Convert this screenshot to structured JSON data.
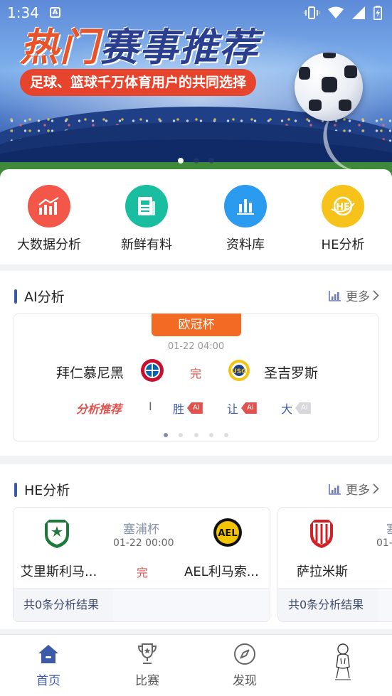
{
  "status_bar": {
    "time": "1:34",
    "notif_letter": "A"
  },
  "banner": {
    "title_part1": "热门",
    "title_part2": "赛事推荐",
    "subtitle": "足球、篮球千万体育用户的共同选择",
    "dots": 3,
    "active_dot": 0
  },
  "menu": [
    {
      "label": "大数据分析",
      "icon": "bar-chart-trend-icon",
      "color": "#f2574a"
    },
    {
      "label": "新鲜有料",
      "icon": "news-doc-icon",
      "color": "#19bd9f"
    },
    {
      "label": "资料库",
      "icon": "database-bars-icon",
      "color": "#2b9bef"
    },
    {
      "label": "HE分析",
      "icon": "he-globe-icon",
      "color": "#f7c21a"
    }
  ],
  "ai_section": {
    "title": "AI分析",
    "more": "更多",
    "match": {
      "league": "欧冠杯",
      "time": "01-22 04:00",
      "home": "拜仁慕尼黑",
      "away": "圣吉罗斯",
      "status": "完",
      "recommend_label": "分析推荐",
      "separator": "I",
      "picks": [
        {
          "label": "胜",
          "tag": "AI"
        },
        {
          "label": "让",
          "tag": "AI"
        },
        {
          "label": "大",
          "tag": "AI"
        }
      ]
    },
    "pager_count": 5,
    "pager_active": 0
  },
  "he_section": {
    "title": "HE分析",
    "more": "更多",
    "cards": [
      {
        "league": "塞浦杯",
        "time": "01-22 00:00",
        "home": "艾里斯利马...",
        "away": "AEL利马索...",
        "status": "完",
        "footer": "共0条分析结果"
      },
      {
        "league": "塞",
        "time": "01-",
        "home": "萨拉米斯",
        "away": "",
        "status": "",
        "footer": "共0条分析结果"
      }
    ]
  },
  "bottom_nav": [
    {
      "label": "首页",
      "icon": "home-icon",
      "active": true
    },
    {
      "label": "比赛",
      "icon": "trophy-icon",
      "active": false
    },
    {
      "label": "发现",
      "icon": "compass-icon",
      "active": false
    },
    {
      "label": "",
      "icon": "avatar-sketch-icon",
      "active": false
    }
  ],
  "colors": {
    "accent": "#3d5aa8",
    "danger": "#e0524e",
    "orange": "#f36a22"
  }
}
